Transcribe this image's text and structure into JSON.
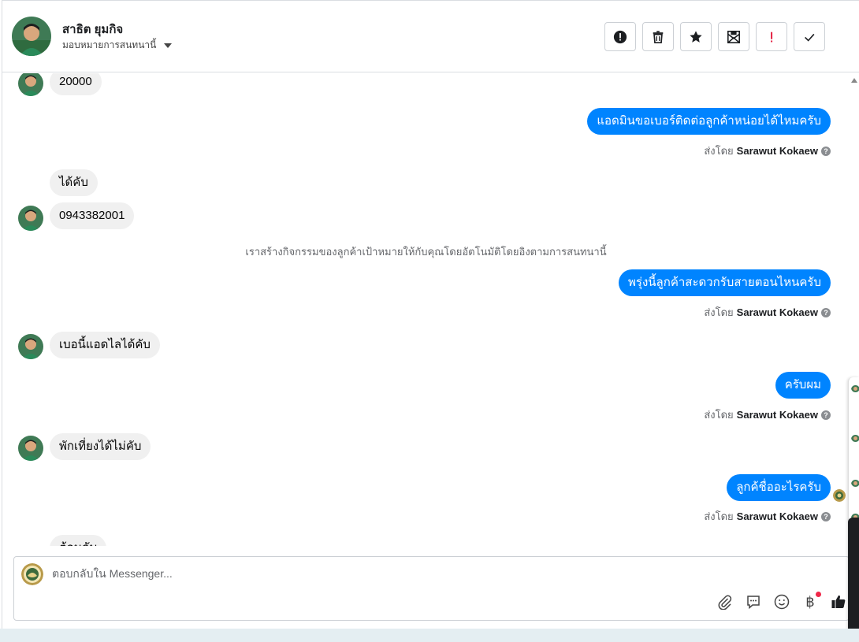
{
  "header": {
    "name": "สาธิต ยุมกิจ",
    "assign_label": "มอบหมายการสนทนานี้",
    "actions": [
      {
        "icon": "alert-circle-icon",
        "name": "mark-spam-button"
      },
      {
        "icon": "trash-icon",
        "name": "delete-button"
      },
      {
        "icon": "star-icon",
        "name": "star-button"
      },
      {
        "icon": "mark-unread-icon",
        "name": "mark-unread-button"
      },
      {
        "icon": "exclamation-icon",
        "name": "follow-up-button"
      },
      {
        "icon": "check-icon",
        "name": "done-button"
      }
    ]
  },
  "messages": {
    "m1_in": "20000",
    "m2_out": "แอดมินขอเบอร์ติดต่อลูกค้าหน่อยได้ไหมครับ",
    "m3_in": "ได้คับ",
    "m4_in": "0943382001",
    "system": "เราสร้างกิจกรรมของลูกค้าเป้าหมายให้กับคุณโดยอัตโนมัติโดยอิงตามการสนทนานี้",
    "m5_out": "พรุ่งนี้ลูกค้าสะดวกรับสายตอนไหนครับ",
    "m6_in": "เบอนี้แอดไลได้คับ",
    "m7_out": "ครับผม",
    "m8_in": "พักเที่ยงได้ไม่คับ",
    "m9_out": "ลูกค้ชื่ออะไรครับ",
    "m10_in": "ต้อมคับ"
  },
  "sent_by": {
    "prefix": "ส่งโดย",
    "agent": "Sarawut Kokaew"
  },
  "composer": {
    "placeholder": "ตอบกลับใน Messenger..."
  },
  "colors": {
    "outgoing_bubble": "#0084ff",
    "incoming_bubble": "#f0f0f0",
    "notification_dot": "#f02849"
  }
}
